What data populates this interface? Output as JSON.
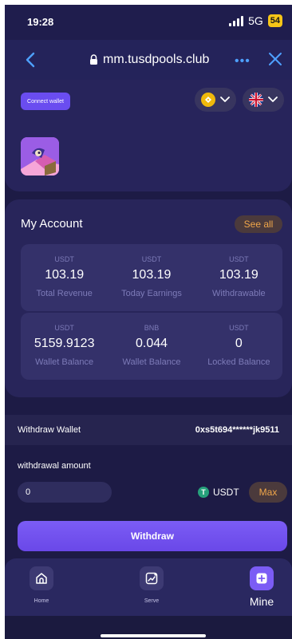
{
  "status_bar": {
    "time": "19:28",
    "network": "5G",
    "battery": "54"
  },
  "browser": {
    "url": "mm.tusdpools.club",
    "more_label": "•••"
  },
  "header": {
    "connect_wallet_label": "Connect wallet"
  },
  "account": {
    "title": "My Account",
    "see_all_label": "See all",
    "stats_row1": [
      {
        "unit": "USDT",
        "value": "103.19",
        "label": "Total Revenue"
      },
      {
        "unit": "USDT",
        "value": "103.19",
        "label": "Today Earnings"
      },
      {
        "unit": "USDT",
        "value": "103.19",
        "label": "Withdrawable"
      }
    ],
    "stats_row2": [
      {
        "unit": "USDT",
        "value": "5159.9123",
        "label": "Wallet Balance"
      },
      {
        "unit": "BNB",
        "value": "0.044",
        "label": "Wallet Balance"
      },
      {
        "unit": "USDT",
        "value": "0",
        "label": "Locked Balance"
      }
    ]
  },
  "withdraw_wallet": {
    "label": "Withdraw Wallet",
    "address": "0xs5t694******jk9511"
  },
  "withdraw": {
    "amount_label": "withdrawal amount",
    "amount_value": "0",
    "token": "USDT",
    "token_icon": "tether-icon",
    "max_label": "Max",
    "button_label": "Withdraw"
  },
  "tabs": [
    {
      "label": "Home",
      "icon": "home-icon"
    },
    {
      "label": "Serve",
      "icon": "chart-icon"
    },
    {
      "label": "Mine",
      "icon": "plus-square-icon"
    }
  ],
  "colors": {
    "background": "#1d1b45",
    "accent": "#7b5cf5",
    "highlight": "#f0a64a",
    "link": "#4ea0ff"
  }
}
